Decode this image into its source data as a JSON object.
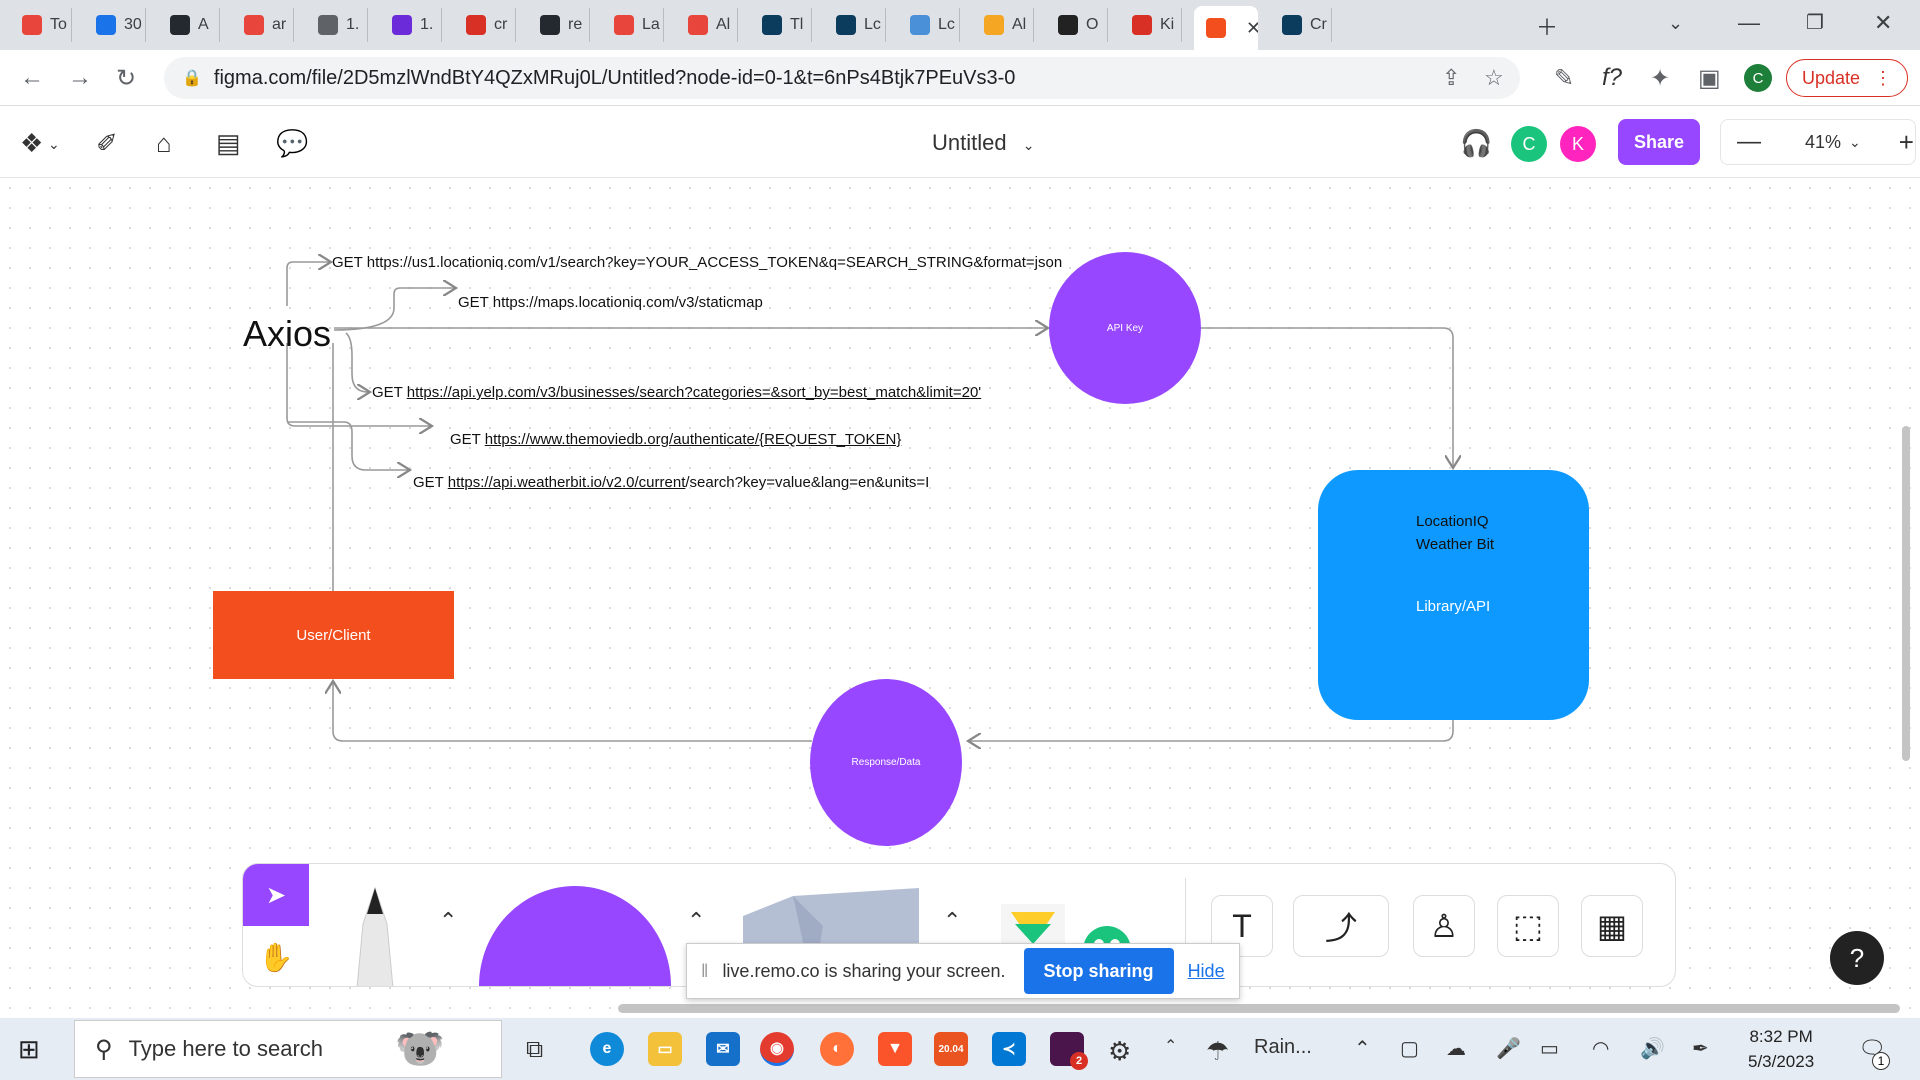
{
  "browser": {
    "tabs": [
      {
        "label": "To",
        "color": "#e8453c"
      },
      {
        "label": "30",
        "color": "#1a73e8"
      },
      {
        "label": "A",
        "color": "#24292f"
      },
      {
        "label": "ar",
        "color": "#e8453c"
      },
      {
        "label": "1.",
        "color": "#5f6368"
      },
      {
        "label": "1.",
        "color": "#6c2bd9"
      },
      {
        "label": "cr",
        "color": "#d93025"
      },
      {
        "label": "re",
        "color": "#24292f"
      },
      {
        "label": "La",
        "color": "#e8453c"
      },
      {
        "label": "Al",
        "color": "#e8453c"
      },
      {
        "label": "Tl",
        "color": "#0b3c5d"
      },
      {
        "label": "Lc",
        "color": "#0b3c5d"
      },
      {
        "label": "Lc",
        "color": "#4a90d9"
      },
      {
        "label": "Al",
        "color": "#f5a623"
      },
      {
        "label": "O",
        "color": "#222222"
      },
      {
        "label": "Ki",
        "color": "#d93025"
      },
      {
        "label": "",
        "color": "#f24e1e"
      },
      {
        "label": "Cr",
        "color": "#0b3c5d"
      }
    ],
    "url": "figma.com/file/2D5mzlWndBtY4QZxMRuj0L/Untitled?node-id=0-1&t=6nPs4Btjk7PEuVs3-0",
    "profile_initial": "C",
    "update_label": "Update"
  },
  "figma": {
    "doc_title": "Untitled",
    "avatars": [
      {
        "initial": "C",
        "color": "#1bc47d"
      },
      {
        "initial": "K",
        "color": "#ff24bd"
      }
    ],
    "share_label": "Share",
    "zoom": "41%"
  },
  "diagram": {
    "axios_label": "Axios",
    "api_key_label": "API Key",
    "response_label": "Response/Data",
    "user_label": "User/Client",
    "lib_line1": "LocationIQ",
    "lib_line2": "Weather Bit",
    "lib_line3": "Library/API",
    "requests": [
      {
        "prefix": "GET https://us1.locationiq.com/v1/search?key=YOUR_ACCESS_TOKEN&q=SEARCH_STRING&format=json",
        "link": "",
        "suffix": ""
      },
      {
        "prefix": "GET https://maps.locationiq.com/v3/staticmap",
        "link": "",
        "suffix": ""
      },
      {
        "prefix": "GET ",
        "link": "https://api.yelp.com/v3/businesses/search?categories=&sort_by=best_match&limit=20'",
        "suffix": ""
      },
      {
        "prefix": "GET ",
        "link": "https://www.themoviedb.org/authenticate/{REQUEST_TOKEN}",
        "suffix": ""
      },
      {
        "prefix": "GET ",
        "link": "https://api.weatherbit.io/v2.0/current",
        "suffix": "/search?key=value&lang=en&units=I"
      }
    ]
  },
  "screen_share": {
    "message": "live.remo.co is sharing your screen.",
    "stop_label": "Stop sharing",
    "hide_label": "Hide"
  },
  "taskbar": {
    "search_placeholder": "Type here to search",
    "weather": "Rain...",
    "time": "8:32 PM",
    "date": "5/3/2023",
    "notification_count": "1",
    "slack_badge": "2",
    "ubuntu_label": "20.04"
  }
}
